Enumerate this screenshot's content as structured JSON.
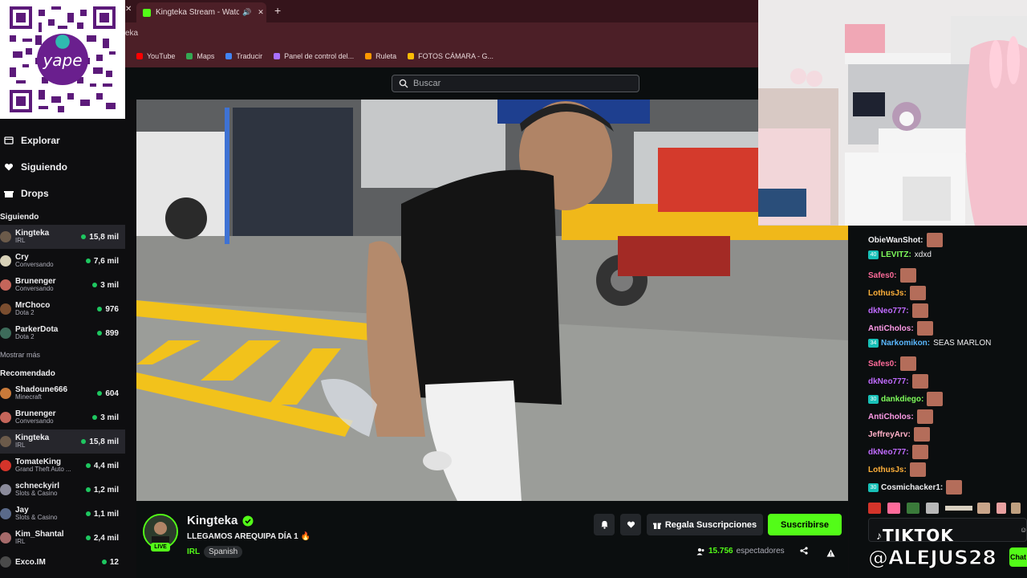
{
  "browser": {
    "tab_title": "Kingteka Stream - Watch Li",
    "url_fragment": "eka",
    "bookmarks": [
      {
        "label": "YouTube",
        "color": "#ff0000"
      },
      {
        "label": "Maps",
        "color": "#34a853"
      },
      {
        "label": "Traducir",
        "color": "#4285f4"
      },
      {
        "label": "Panel de control del...",
        "color": "#a970ff"
      },
      {
        "label": "Ruleta",
        "color": "#ff9800"
      },
      {
        "label": "FOTOS CÁMARA - G...",
        "color": "#fbbc05"
      }
    ]
  },
  "qr": {
    "brand": "yape"
  },
  "search": {
    "placeholder": "Buscar"
  },
  "sidebar": {
    "nav": [
      {
        "label": "Explorar",
        "icon": "compass-icon"
      },
      {
        "label": "Siguiendo",
        "icon": "heart-icon"
      },
      {
        "label": "Drops",
        "icon": "gift-icon"
      }
    ],
    "following_title": "Siguiendo",
    "following": [
      {
        "name": "Kingteka",
        "game": "IRL",
        "viewers": "15,8 mil",
        "color": "#6b5a4a"
      },
      {
        "name": "Cry",
        "game": "Conversando",
        "viewers": "7,6 mil",
        "color": "#d8d1b8"
      },
      {
        "name": "Brunenger",
        "game": "Conversando",
        "viewers": "3 mil",
        "color": "#c4655a"
      },
      {
        "name": "MrChoco",
        "game": "Dota 2",
        "viewers": "976",
        "color": "#7a4d2f"
      },
      {
        "name": "ParkerDota",
        "game": "Dota 2",
        "viewers": "899",
        "color": "#3d6b5a"
      }
    ],
    "show_more": "Mostrar más",
    "recommended_title": "Recomendado",
    "recommended": [
      {
        "name": "Shadoune666",
        "game": "Minecraft",
        "viewers": "604",
        "color": "#c97a3a"
      },
      {
        "name": "Brunenger",
        "game": "Conversando",
        "viewers": "3 mil",
        "color": "#c4655a"
      },
      {
        "name": "Kingteka",
        "game": "IRL",
        "viewers": "15,8 mil",
        "color": "#6b5a4a"
      },
      {
        "name": "TomateKing",
        "game": "Grand Theft Auto ...",
        "viewers": "4,4 mil",
        "color": "#d4342a"
      },
      {
        "name": "schneckyirl",
        "game": "Slots & Casino",
        "viewers": "1,2 mil",
        "color": "#8a8a9a"
      },
      {
        "name": "Jay",
        "game": "Slots & Casino",
        "viewers": "1,1 mil",
        "color": "#5a6a8a"
      },
      {
        "name": "Kim_Shantal",
        "game": "IRL",
        "viewers": "2,4 mil",
        "color": "#a56a6a"
      },
      {
        "name": "Exco.IM",
        "game": "",
        "viewers": "12",
        "color": "#4a4a4a"
      }
    ]
  },
  "channel": {
    "name": "Kingteka",
    "title": "LLEGAMOS AREQUIPA DÍA 1 🔥",
    "category": "IRL",
    "language": "Spanish",
    "live_badge": "LIVE",
    "viewers": "15.756",
    "viewers_label": "espectadores",
    "subs_button": "Regala Suscripciones",
    "subscribe_button": "Suscribirse"
  },
  "chat": {
    "messages": [
      {
        "user": "ObieWanShot:",
        "text": "",
        "color": "#efeff1",
        "badge": "",
        "emote": true
      },
      {
        "user": "LEVITZ:",
        "text": "xdxd",
        "color": "#7efc5b",
        "badge": "40",
        "emote": false
      },
      {
        "user": "Safes0:",
        "text": "",
        "color": "#ff6b9a",
        "badge": "",
        "emote": true
      },
      {
        "user": "LothusJs:",
        "text": "",
        "color": "#ffb03a",
        "badge": "",
        "emote": true
      },
      {
        "user": "dkNeo777:",
        "text": "",
        "color": "#c06bff",
        "badge": "",
        "emote": true
      },
      {
        "user": "AntiCholos:",
        "text": "",
        "color": "#ff9be8",
        "badge": "",
        "emote": true
      },
      {
        "user": "Narkomikon:",
        "text": "SEAS MARLON",
        "color": "#5ab8ff",
        "badge": "34",
        "emote": false
      },
      {
        "user": "Safes0:",
        "text": "",
        "color": "#ff6b9a",
        "badge": "",
        "emote": true
      },
      {
        "user": "dkNeo777:",
        "text": "",
        "color": "#c06bff",
        "badge": "",
        "emote": true
      },
      {
        "user": "dankdiego:",
        "text": "",
        "color": "#7efc5b",
        "badge": "30",
        "emote": true
      },
      {
        "user": "AntiCholos:",
        "text": "",
        "color": "#ff9be8",
        "badge": "",
        "emote": true
      },
      {
        "user": "JeffreyArv:",
        "text": "",
        "color": "#ffb0c8",
        "badge": "",
        "emote": true
      },
      {
        "user": "dkNeo777:",
        "text": "",
        "color": "#c06bff",
        "badge": "",
        "emote": true
      },
      {
        "user": "LothusJs:",
        "text": "",
        "color": "#ffb03a",
        "badge": "",
        "emote": true
      },
      {
        "user": "Cosmichacker1:",
        "text": "",
        "color": "#efeff1",
        "badge": "30",
        "emote": true
      }
    ],
    "overlay_tiktok": "TIKTOK",
    "overlay_handle": "@ALEJUS28",
    "chat_button": "Chat"
  }
}
